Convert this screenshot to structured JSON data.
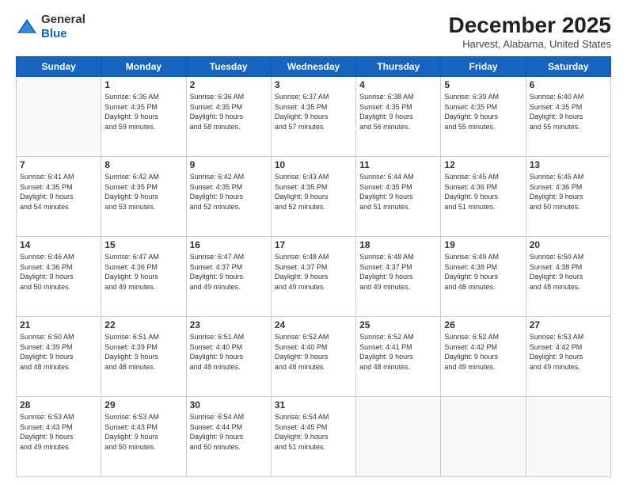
{
  "logo": {
    "general": "General",
    "blue": "Blue"
  },
  "title": "December 2025",
  "subtitle": "Harvest, Alabama, United States",
  "days_header": [
    "Sunday",
    "Monday",
    "Tuesday",
    "Wednesday",
    "Thursday",
    "Friday",
    "Saturday"
  ],
  "weeks": [
    [
      {
        "day": "",
        "info": ""
      },
      {
        "day": "1",
        "info": "Sunrise: 6:36 AM\nSunset: 4:35 PM\nDaylight: 9 hours\nand 59 minutes."
      },
      {
        "day": "2",
        "info": "Sunrise: 6:36 AM\nSunset: 4:35 PM\nDaylight: 9 hours\nand 58 minutes."
      },
      {
        "day": "3",
        "info": "Sunrise: 6:37 AM\nSunset: 4:35 PM\nDaylight: 9 hours\nand 57 minutes."
      },
      {
        "day": "4",
        "info": "Sunrise: 6:38 AM\nSunset: 4:35 PM\nDaylight: 9 hours\nand 56 minutes."
      },
      {
        "day": "5",
        "info": "Sunrise: 6:39 AM\nSunset: 4:35 PM\nDaylight: 9 hours\nand 55 minutes."
      },
      {
        "day": "6",
        "info": "Sunrise: 6:40 AM\nSunset: 4:35 PM\nDaylight: 9 hours\nand 55 minutes."
      }
    ],
    [
      {
        "day": "7",
        "info": "Sunrise: 6:41 AM\nSunset: 4:35 PM\nDaylight: 9 hours\nand 54 minutes."
      },
      {
        "day": "8",
        "info": "Sunrise: 6:42 AM\nSunset: 4:35 PM\nDaylight: 9 hours\nand 53 minutes."
      },
      {
        "day": "9",
        "info": "Sunrise: 6:42 AM\nSunset: 4:35 PM\nDaylight: 9 hours\nand 52 minutes."
      },
      {
        "day": "10",
        "info": "Sunrise: 6:43 AM\nSunset: 4:35 PM\nDaylight: 9 hours\nand 52 minutes."
      },
      {
        "day": "11",
        "info": "Sunrise: 6:44 AM\nSunset: 4:35 PM\nDaylight: 9 hours\nand 51 minutes."
      },
      {
        "day": "12",
        "info": "Sunrise: 6:45 AM\nSunset: 4:36 PM\nDaylight: 9 hours\nand 51 minutes."
      },
      {
        "day": "13",
        "info": "Sunrise: 6:45 AM\nSunset: 4:36 PM\nDaylight: 9 hours\nand 50 minutes."
      }
    ],
    [
      {
        "day": "14",
        "info": "Sunrise: 6:46 AM\nSunset: 4:36 PM\nDaylight: 9 hours\nand 50 minutes."
      },
      {
        "day": "15",
        "info": "Sunrise: 6:47 AM\nSunset: 4:36 PM\nDaylight: 9 hours\nand 49 minutes."
      },
      {
        "day": "16",
        "info": "Sunrise: 6:47 AM\nSunset: 4:37 PM\nDaylight: 9 hours\nand 49 minutes."
      },
      {
        "day": "17",
        "info": "Sunrise: 6:48 AM\nSunset: 4:37 PM\nDaylight: 9 hours\nand 49 minutes."
      },
      {
        "day": "18",
        "info": "Sunrise: 6:48 AM\nSunset: 4:37 PM\nDaylight: 9 hours\nand 49 minutes."
      },
      {
        "day": "19",
        "info": "Sunrise: 6:49 AM\nSunset: 4:38 PM\nDaylight: 9 hours\nand 48 minutes."
      },
      {
        "day": "20",
        "info": "Sunrise: 6:50 AM\nSunset: 4:38 PM\nDaylight: 9 hours\nand 48 minutes."
      }
    ],
    [
      {
        "day": "21",
        "info": "Sunrise: 6:50 AM\nSunset: 4:39 PM\nDaylight: 9 hours\nand 48 minutes."
      },
      {
        "day": "22",
        "info": "Sunrise: 6:51 AM\nSunset: 4:39 PM\nDaylight: 9 hours\nand 48 minutes."
      },
      {
        "day": "23",
        "info": "Sunrise: 6:51 AM\nSunset: 4:40 PM\nDaylight: 9 hours\nand 48 minutes."
      },
      {
        "day": "24",
        "info": "Sunrise: 6:52 AM\nSunset: 4:40 PM\nDaylight: 9 hours\nand 48 minutes."
      },
      {
        "day": "25",
        "info": "Sunrise: 6:52 AM\nSunset: 4:41 PM\nDaylight: 9 hours\nand 48 minutes."
      },
      {
        "day": "26",
        "info": "Sunrise: 6:52 AM\nSunset: 4:42 PM\nDaylight: 9 hours\nand 49 minutes."
      },
      {
        "day": "27",
        "info": "Sunrise: 6:53 AM\nSunset: 4:42 PM\nDaylight: 9 hours\nand 49 minutes."
      }
    ],
    [
      {
        "day": "28",
        "info": "Sunrise: 6:53 AM\nSunset: 4:43 PM\nDaylight: 9 hours\nand 49 minutes."
      },
      {
        "day": "29",
        "info": "Sunrise: 6:53 AM\nSunset: 4:43 PM\nDaylight: 9 hours\nand 50 minutes."
      },
      {
        "day": "30",
        "info": "Sunrise: 6:54 AM\nSunset: 4:44 PM\nDaylight: 9 hours\nand 50 minutes."
      },
      {
        "day": "31",
        "info": "Sunrise: 6:54 AM\nSunset: 4:45 PM\nDaylight: 9 hours\nand 51 minutes."
      },
      {
        "day": "",
        "info": ""
      },
      {
        "day": "",
        "info": ""
      },
      {
        "day": "",
        "info": ""
      }
    ]
  ]
}
